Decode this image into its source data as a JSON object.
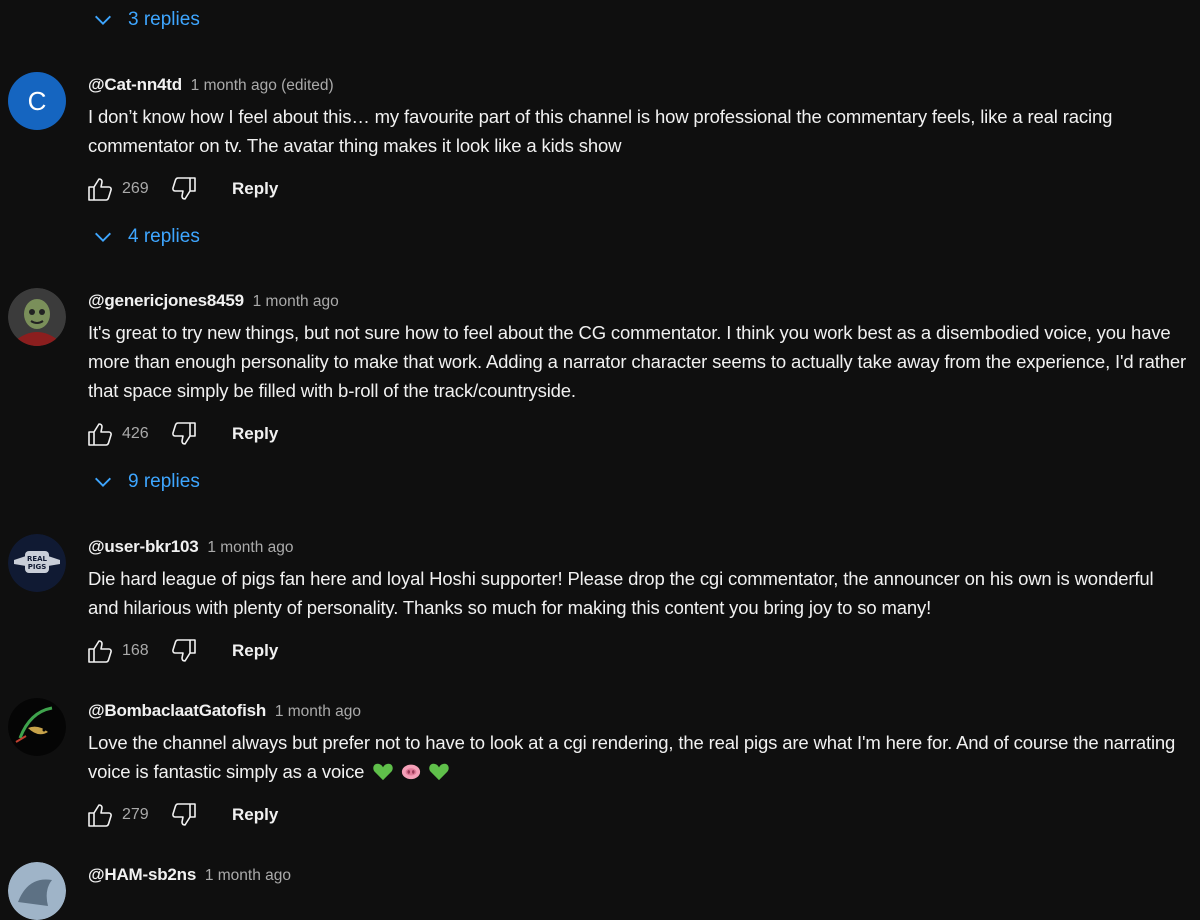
{
  "threads": [
    {
      "replies_label": "3 replies"
    },
    {
      "replies_label": "4 replies"
    },
    {
      "replies_label": "9 replies"
    }
  ],
  "comments": [
    {
      "avatar_letter": "C",
      "author": "@Cat-nn4td",
      "time": "1 month ago (edited)",
      "text": "I don’t know how I feel about this… my favourite part of this channel is how professional the commentary feels, like a real racing commentator on tv. The avatar thing makes it look like a kids show",
      "likes": "269",
      "reply_label": "Reply"
    },
    {
      "author": "@genericjones8459",
      "time": "1 month ago",
      "text": "It's great to try new things, but not sure how to feel about the CG commentator. I think you work best as a disembodied voice, you have more than enough personality to make that work. Adding a narrator character seems to actually take away from the experience, I'd rather that space simply be filled with b-roll of the track/countryside.",
      "likes": "426",
      "reply_label": "Reply"
    },
    {
      "author": "@user-bkr103",
      "time": "1 month ago",
      "text": "Die hard league of pigs fan here and loyal Hoshi supporter! Please drop the cgi commentator, the announcer on his own is wonderful and hilarious with plenty of personality. Thanks so much for making this content you bring joy to so many!",
      "likes": "168",
      "reply_label": "Reply",
      "avatar_logo_text": "REAL PIGS"
    },
    {
      "author": "@BombaclaatGatofish",
      "time": "1 month ago",
      "text": "Love the channel always but prefer not to have to look at a cgi rendering, the real pigs are what I'm here for. And of course the narrating voice is fantastic simply as a voice",
      "emojis": [
        "green-heart",
        "pig-nose",
        "green-heart"
      ],
      "likes": "279",
      "reply_label": "Reply"
    },
    {
      "author": "@HAM-sb2ns",
      "time": "1 month ago"
    }
  ],
  "colors": {
    "background": "#0f0f0f",
    "link_blue": "#3ea6ff",
    "muted_text": "#aaaaaa",
    "avatar_blue": "#1565c0"
  }
}
